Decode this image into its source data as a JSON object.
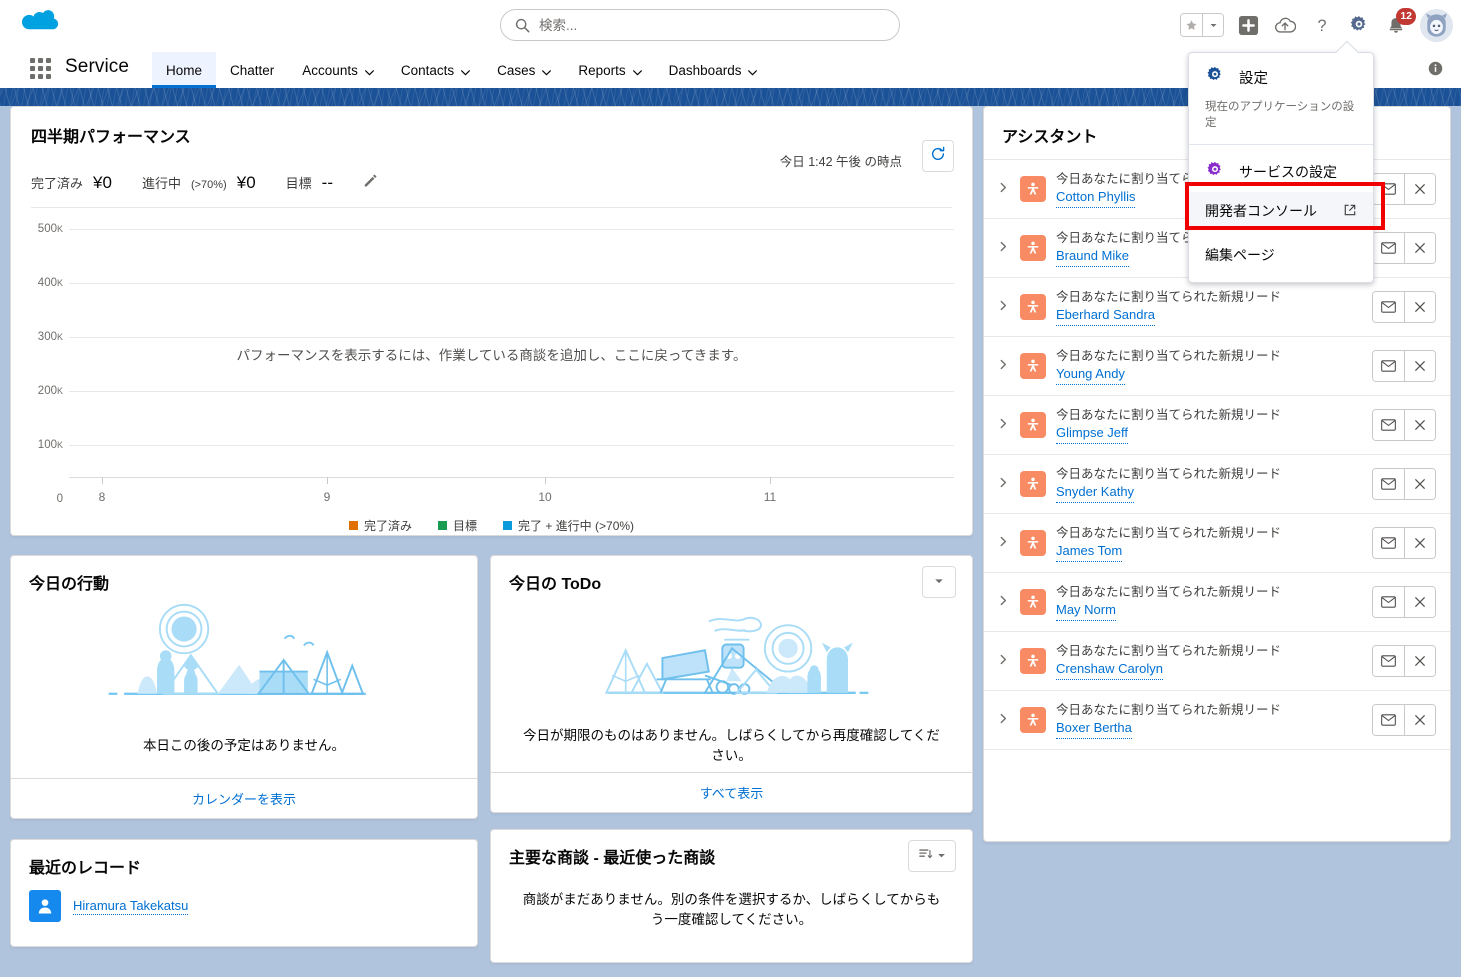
{
  "header": {
    "logo_icon": "salesforce-cloud-logo",
    "search": {
      "placeholder": "検索...",
      "value": "",
      "icon": "search-icon"
    },
    "utilities": {
      "favorites_star_icon": "star-icon",
      "favorites_caret_icon": "chevron-down-icon",
      "add_icon": "plus-icon",
      "cloud_icon": "cloud-upload-icon",
      "help_icon": "question-mark-icon",
      "setup_icon": "gear-icon",
      "notifications_icon": "bell-icon",
      "notifications_count": "12",
      "avatar_icon": "user-avatar"
    }
  },
  "app_nav": {
    "waffle_icon": "app-launcher-icon",
    "app_name": "Service",
    "info_icon": "info-icon",
    "tabs": [
      {
        "label": "Home",
        "has_caret": false,
        "active": true
      },
      {
        "label": "Chatter",
        "has_caret": false,
        "active": false
      },
      {
        "label": "Accounts",
        "has_caret": true,
        "active": false
      },
      {
        "label": "Contacts",
        "has_caret": true,
        "active": false
      },
      {
        "label": "Cases",
        "has_caret": true,
        "active": false
      },
      {
        "label": "Reports",
        "has_caret": true,
        "active": false
      },
      {
        "label": "Dashboards",
        "has_caret": true,
        "active": false
      }
    ]
  },
  "setup_menu": {
    "section1": {
      "icon": "gear-icon",
      "title": "設定",
      "subtitle": "現在のアプリケーションの設定"
    },
    "items": [
      {
        "label": "サービスの設定",
        "icon": "gear-icon",
        "external": false,
        "highlighted": false
      },
      {
        "label": "開発者コンソール",
        "icon": "external-link-icon",
        "external": true,
        "highlighted": true
      },
      {
        "label": "編集ページ",
        "icon": "",
        "external": false,
        "highlighted": false
      }
    ],
    "highlight_color": "#f00000"
  },
  "performance": {
    "title": "四半期パフォーマンス",
    "as_of": "今日 1:42 午後 の時点",
    "refresh_icon": "refresh-icon",
    "edit_icon": "pencil-icon",
    "stats": [
      {
        "label": "完了済み",
        "sub": "",
        "value": "¥0"
      },
      {
        "label": "進行中",
        "sub": "(>70%)",
        "value": "¥0"
      },
      {
        "label": "目標",
        "sub": "",
        "value": "--"
      }
    ],
    "empty_message": "パフォーマンスを表示するには、作業している商談を追加し、ここに戻ってきます。"
  },
  "chart_data": {
    "type": "line",
    "title": "四半期パフォーマンス",
    "xlabel": "",
    "ylabel": "",
    "x": [
      8,
      9,
      10,
      11
    ],
    "xtick_labels": [
      "8",
      "9",
      "10",
      "11"
    ],
    "ytick_labels": [
      "0",
      "100K",
      "200K",
      "300K",
      "400K",
      "500K"
    ],
    "ytick_values": [
      0,
      100000,
      200000,
      300000,
      400000,
      500000
    ],
    "ylim": [
      0,
      500000
    ],
    "xlim": [
      8,
      11
    ],
    "grid": true,
    "legend_position": "bottom",
    "series": [
      {
        "name": "完了済み",
        "color": "#e07000",
        "values": []
      },
      {
        "name": "目標",
        "color": "#1a9b52",
        "values": []
      },
      {
        "name": "完了 + 進行中 (>70%)",
        "color": "#0a9bdd",
        "values": []
      }
    ],
    "annotations": [
      "パフォーマンスを表示するには、作業している商談を追加し、ここに戻ってきます。"
    ]
  },
  "today_events": {
    "title": "今日の行動",
    "illustration": "camping-scene-illustration",
    "empty_message": "本日この後の予定はありません。",
    "footer_link": "カレンダーを表示"
  },
  "today_todo": {
    "title": "今日の ToDo",
    "menu_icon": "chevron-down-icon",
    "illustration": "robot-campsite-illustration",
    "empty_message": "今日が期限のものはありません。しばらくしてから再度確認してください。",
    "footer_link": "すべて表示"
  },
  "recent_records": {
    "title": "最近のレコード",
    "items": [
      {
        "name": "Hiramura Takekatsu",
        "icon": "contact-avatar-icon"
      }
    ]
  },
  "key_deals": {
    "title": "主要な商談 - 最近使った商談",
    "sort_icon": "sort-icon",
    "caret_icon": "chevron-down-icon",
    "empty_message": "商談がまだありません。別の条件を選択するか、しばらくしてからもう一度確認してください。"
  },
  "assistant": {
    "title": "アシスタント",
    "item_icon": "lead-icon",
    "expand_icon": "chevron-right-icon",
    "email_icon": "envelope-icon",
    "dismiss_icon": "close-icon",
    "items": [
      {
        "description": "今日あなたに割り当てられた新規リード",
        "name": "Cotton Phyllis"
      },
      {
        "description": "今日あなたに割り当てられた新規リード",
        "name": "Braund Mike"
      },
      {
        "description": "今日あなたに割り当てられた新規リード",
        "name": "Eberhard Sandra"
      },
      {
        "description": "今日あなたに割り当てられた新規リード",
        "name": "Young Andy"
      },
      {
        "description": "今日あなたに割り当てられた新規リード",
        "name": "Glimpse Jeff"
      },
      {
        "description": "今日あなたに割り当てられた新規リード",
        "name": "Snyder Kathy"
      },
      {
        "description": "今日あなたに割り当てられた新規リード",
        "name": "James Tom"
      },
      {
        "description": "今日あなたに割り当てられた新規リード",
        "name": "May Norm"
      },
      {
        "description": "今日あなたに割り当てられた新規リード",
        "name": "Crenshaw Carolyn"
      },
      {
        "description": "今日あなたに割り当てられた新規リード",
        "name": "Boxer Bertha"
      }
    ]
  }
}
